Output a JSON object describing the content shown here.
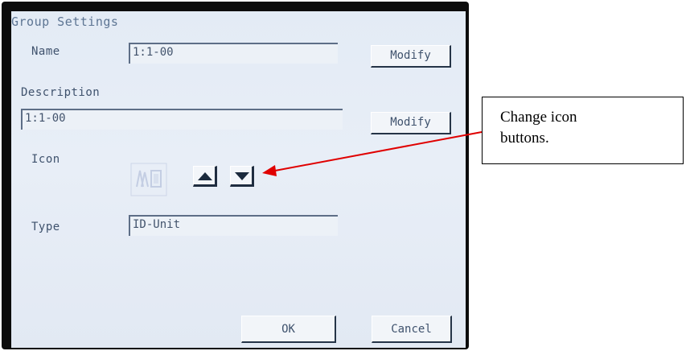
{
  "dialog": {
    "title": "Group Settings",
    "name_label": "Name",
    "name_value": "1:1-00",
    "description_label": "Description",
    "description_value": "1:1-00",
    "icon_label": "Icon",
    "type_label": "Type",
    "type_value": "ID-Unit",
    "modify_label": "Modify",
    "ok_label": "OK",
    "cancel_label": "Cancel"
  },
  "callout": {
    "text_line1": "Change icon",
    "text_line2": "buttons."
  },
  "colors": {
    "screen_bg": "#e5ecf5",
    "text": "#3f526d",
    "arrow": "#e00000"
  },
  "icons": [
    "arrow-up-icon",
    "arrow-down-icon",
    "group-icon"
  ]
}
